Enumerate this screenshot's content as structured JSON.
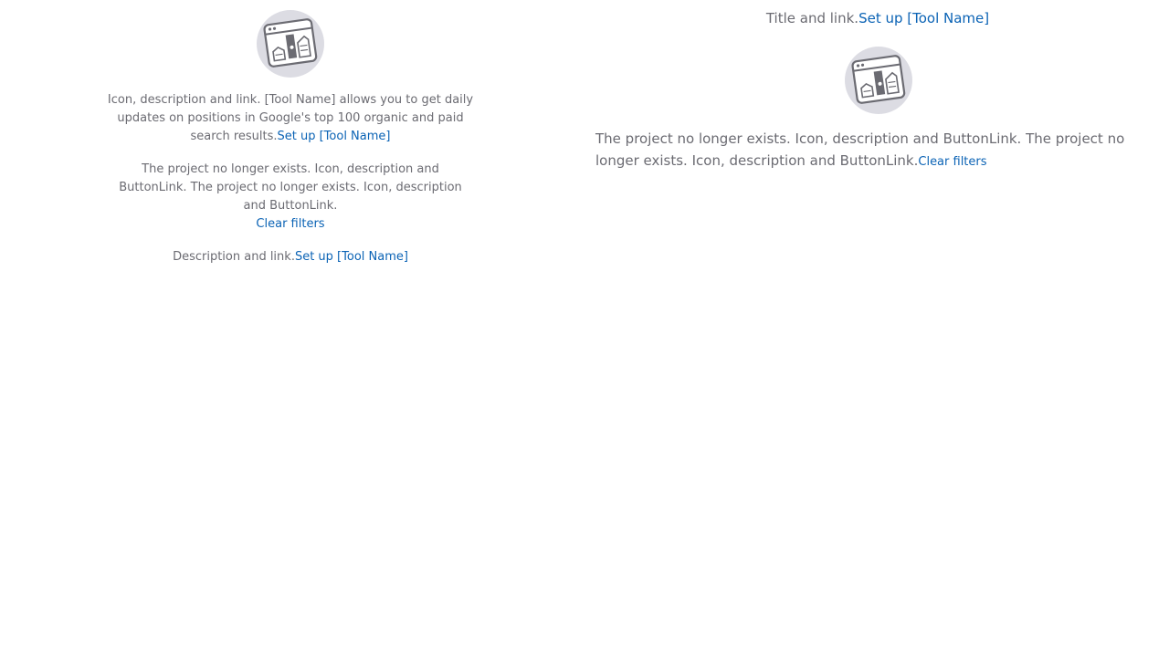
{
  "left": {
    "block_a": {
      "text": "Icon, description and link. [Tool Name] allows you to get daily updates on positions in Google's top 100 organic and paid search results.",
      "link": "Set up [Tool Name]"
    },
    "block_b": {
      "text": "The project no longer exists. Icon, description and ButtonLink. The project no longer exists. Icon, description and ButtonLink.",
      "link": "Clear filters"
    },
    "block_c": {
      "text": "Description and link.",
      "link": "Set up [Tool Name]"
    }
  },
  "right": {
    "title": {
      "text": "Title and link.",
      "link": "Set up [Tool Name]"
    },
    "block": {
      "text": "The project no longer exists. Icon, description and ButtonLink. The project no longer exists. Icon, description and ButtonLink.",
      "link": "Clear filters"
    }
  },
  "icons": {
    "illustration": "browser-chart-illustration-icon"
  },
  "colors": {
    "text": "#6b6b72",
    "link": "#0b63b5",
    "icon_bg": "#dcdce3",
    "icon_stroke": "#6b6b72"
  }
}
